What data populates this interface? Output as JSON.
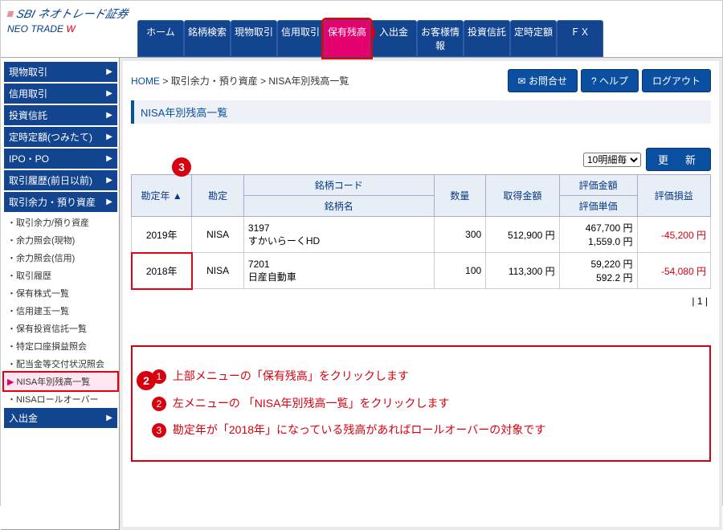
{
  "logo": {
    "brand_prefix": "≡",
    "brand": "SBI ネオトレード証券",
    "sub": "NEO TRADE",
    "sub_accent": "W"
  },
  "topnav": [
    "ホーム",
    "銘柄検索",
    "現物取引",
    "信用取引",
    "保有残高",
    "入出金",
    "お客様情報",
    "投資信託",
    "定時定額",
    "ＦＸ"
  ],
  "topnav_active_index": 4,
  "callouts": {
    "n1": "1",
    "n2": "2",
    "n3": "3"
  },
  "sidebar_groups": [
    {
      "label": "現物取引",
      "items": []
    },
    {
      "label": "信用取引",
      "items": []
    },
    {
      "label": "投資信託",
      "items": []
    },
    {
      "label": "定時定額(つみたて)",
      "items": []
    },
    {
      "label": "IPO・PO",
      "items": []
    },
    {
      "label": "取引履歴(前日以前)",
      "items": []
    },
    {
      "label": "取引余力・預り資産",
      "items": [
        "取引余力/預り資産",
        "余力照会(現物)",
        "余力照会(信用)",
        "取引履歴",
        "保有株式一覧",
        "信用建玉一覧",
        "保有投資信託一覧",
        "特定口座損益照会",
        "配当金等交付状況照会",
        "NISA年別残高一覧",
        "NISAロールオーバー"
      ],
      "active_index": 9
    },
    {
      "label": "入出金",
      "items": []
    }
  ],
  "breadcrumb": {
    "home": "HOME",
    "sep": " > ",
    "p1": "取引余力・預り資産",
    "p2": "NISA年別残高一覧"
  },
  "actions": {
    "contact": "お問合せ",
    "help": "ヘルプ",
    "logout": "ログアウト"
  },
  "section_title": "NISA年別残高一覧",
  "table_controls": {
    "per_page": "10明細毎",
    "refresh": "更　新"
  },
  "table": {
    "headers": {
      "year": "勘定年 ▲",
      "account": "勘定",
      "code_name": "銘柄コード",
      "code_name_sub": "銘柄名",
      "qty": "数量",
      "cost": "取得金額",
      "value": "評価金額",
      "value_sub": "評価単価",
      "pl": "評価損益"
    },
    "rows": [
      {
        "year": "2019年",
        "account": "NISA",
        "code": "3197",
        "name": "すかいらーくHD",
        "qty": "300",
        "cost": "512,900 円",
        "value": "467,700 円",
        "unit": "1,559.0 円",
        "pl": "-45,200 円",
        "highlight": false
      },
      {
        "year": "2018年",
        "account": "NISA",
        "code": "7201",
        "name": "日産自動車",
        "qty": "100",
        "cost": "113,300 円",
        "value": "59,220 円",
        "unit": "592.2 円",
        "pl": "-54,080 円",
        "highlight": true
      }
    ]
  },
  "pager": "| 1 |",
  "instructions": [
    "上部メニューの「保有残高」をクリックします",
    "左メニューの 「NISA年別残高一覧」をクリックします",
    "勘定年が「2018年」になっている残高があればロールオーバーの対象です"
  ]
}
